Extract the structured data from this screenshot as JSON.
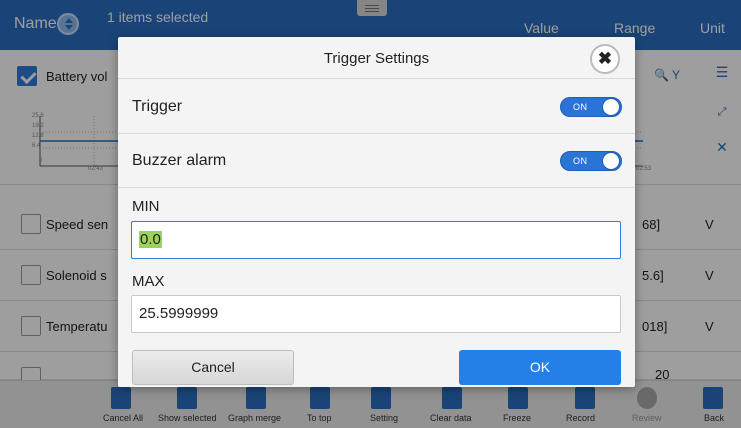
{
  "header": {
    "name_label": "Name",
    "selected_text": "1 items selected",
    "value_label": "Value",
    "range_label": "Range",
    "unit_label": "Unit"
  },
  "rows": [
    {
      "name": "Battery vol",
      "checked": true
    },
    {
      "name": "Speed sen",
      "range": "68]",
      "unit": "V",
      "checked": false
    },
    {
      "name": "Solenoid s",
      "range": "5.6]",
      "unit": "V",
      "checked": false
    },
    {
      "name": "Temperatu",
      "range": "018]",
      "unit": "V",
      "checked": false
    }
  ],
  "mini_graph": {
    "y_ticks": [
      "25.6",
      "19.2",
      "12.8",
      "6.4",
      "0"
    ],
    "x_ticks": [
      "02:43",
      "02:53"
    ]
  },
  "zoom_label": "Y",
  "partial_value": "20",
  "toolbar": [
    {
      "label": "Cancel All",
      "icon": "cancel-all-icon"
    },
    {
      "label": "Show selected",
      "icon": "show-selected-icon"
    },
    {
      "label": "Graph merge",
      "icon": "graph-merge-icon"
    },
    {
      "label": "To top",
      "icon": "to-top-icon"
    },
    {
      "label": "Setting",
      "icon": "setting-icon"
    },
    {
      "label": "Clear data",
      "icon": "clear-data-icon"
    },
    {
      "label": "Freeze",
      "icon": "freeze-icon"
    },
    {
      "label": "Record",
      "icon": "record-icon"
    },
    {
      "label": "Review",
      "icon": "review-icon"
    },
    {
      "label": "Back",
      "icon": "back-arrow-icon"
    }
  ],
  "dialog": {
    "title": "Trigger Settings",
    "trigger": {
      "label": "Trigger",
      "state": "ON"
    },
    "buzzer": {
      "label": "Buzzer alarm",
      "state": "ON"
    },
    "min": {
      "label": "MIN",
      "value": "0.0"
    },
    "max": {
      "label": "MAX",
      "value": "25.5999999"
    },
    "cancel_label": "Cancel",
    "ok_label": "OK"
  },
  "colors": {
    "header_bg": "#2a6fc0",
    "toggle_on": "#2a74d6",
    "ok_button": "#2480e8",
    "selection_highlight": "#9bd25b"
  }
}
